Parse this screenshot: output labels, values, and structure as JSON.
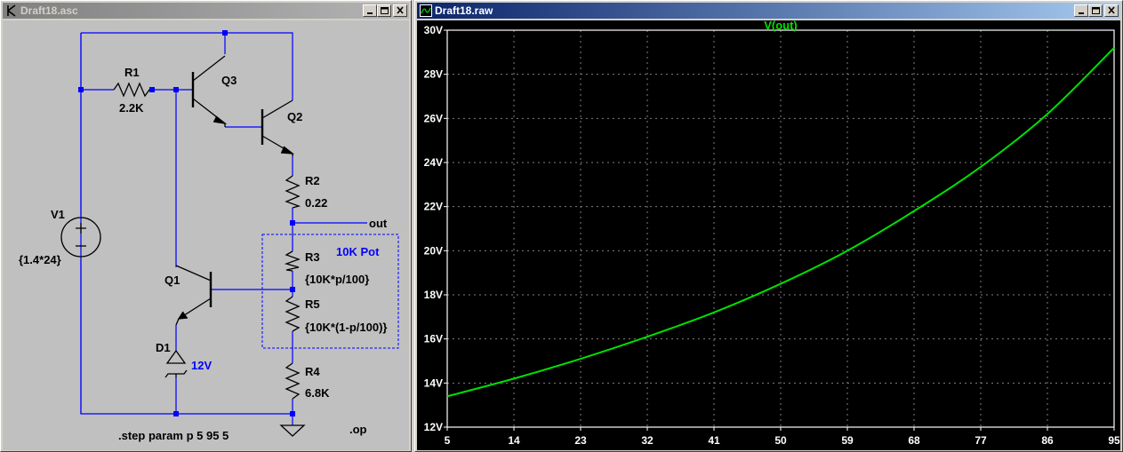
{
  "schematic_window": {
    "title": "Draft18.asc",
    "labels": {
      "r1": "R1",
      "r1_val": "2.2K",
      "q3": "Q3",
      "q2": "Q2",
      "r2": "R2",
      "r2_val": "0.22",
      "out": "out",
      "pot": "10K Pot",
      "r3": "R3",
      "r3_val": "{10K*p/100}",
      "r5": "R5",
      "r5_val": "{10K*(1-p/100)}",
      "r4": "R4",
      "r4_val": "6.8K",
      "v1": "V1",
      "v1_val": "{1.4*24}",
      "q1": "Q1",
      "d1": "D1",
      "d1_val": "12V",
      "step": ".step param p 5 95 5",
      "op": ".op"
    }
  },
  "plot_window": {
    "title": "Draft18.raw",
    "trace_color": "#00e000",
    "wire_color": "#0000ff",
    "junction_color": "#0000ff"
  },
  "chart_data": {
    "type": "line",
    "title": "",
    "xlabel": "",
    "ylabel": "",
    "xlim": [
      5,
      95
    ],
    "ylim": [
      12,
      30
    ],
    "x_ticks": [
      "5",
      "14",
      "23",
      "32",
      "41",
      "50",
      "59",
      "68",
      "77",
      "86",
      "95"
    ],
    "y_ticks": [
      "12V",
      "14V",
      "16V",
      "18V",
      "20V",
      "22V",
      "24V",
      "26V",
      "28V",
      "30V"
    ],
    "grid": true,
    "series": [
      {
        "name": "V(out)",
        "color": "#00e000",
        "x": [
          5,
          14,
          23,
          32,
          41,
          50,
          59,
          68,
          77,
          86,
          95
        ],
        "y": [
          13.4,
          14.2,
          15.1,
          16.1,
          17.2,
          18.5,
          20.0,
          21.8,
          23.8,
          26.2,
          29.2
        ]
      }
    ]
  }
}
